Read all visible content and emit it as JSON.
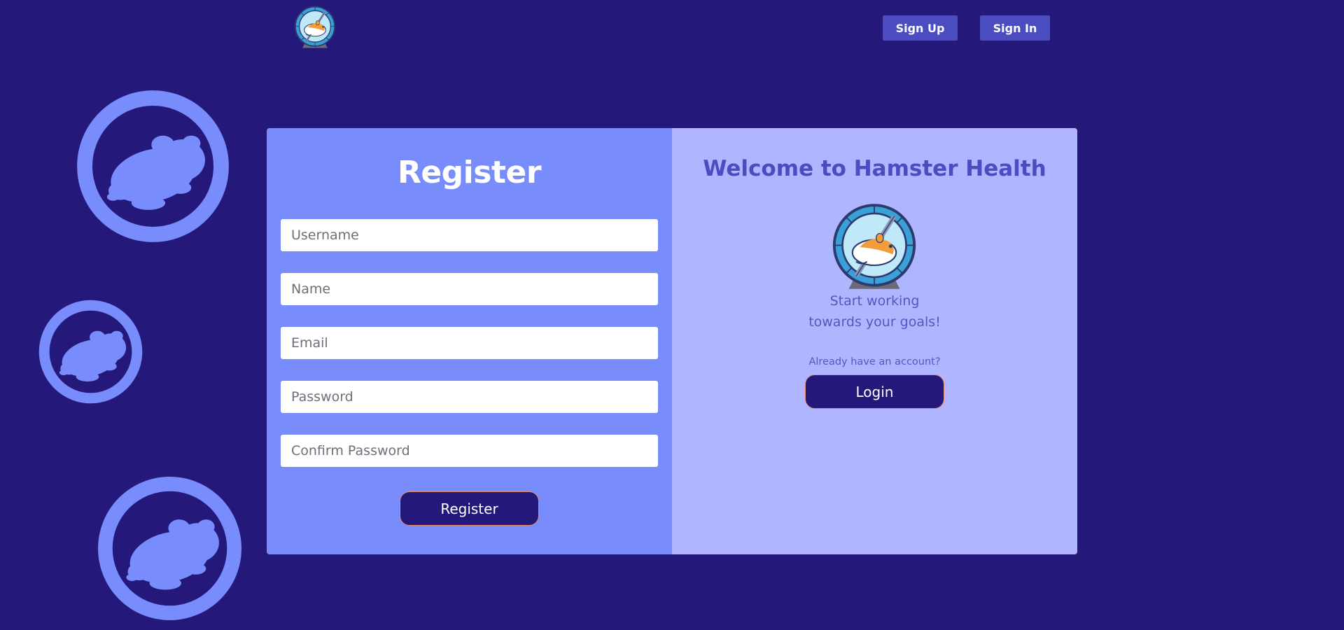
{
  "header": {
    "logo_icon": "hamster-wheel-logo",
    "signup_label": "Sign Up",
    "signin_label": "Sign In"
  },
  "register": {
    "title": "Register",
    "fields": [
      {
        "placeholder": "Username",
        "value": ""
      },
      {
        "placeholder": "Name",
        "value": ""
      },
      {
        "placeholder": "Email",
        "value": ""
      },
      {
        "placeholder": "Password",
        "value": ""
      },
      {
        "placeholder": "Confirm Password",
        "value": ""
      }
    ],
    "submit_label": "Register"
  },
  "welcome": {
    "title": "Welcome to Hamster Health",
    "tagline_line1": "Start working",
    "tagline_line2": "towards your goals!",
    "prompt": "Already have an account?",
    "login_label": "Login"
  },
  "colors": {
    "background": "#25187b",
    "register_panel": "#788cfc",
    "welcome_panel": "#afb5fe",
    "accent": "#4b4cc0",
    "button_bg": "#25187b",
    "button_border": "#e58a6d",
    "decoration": "#788cfc"
  }
}
